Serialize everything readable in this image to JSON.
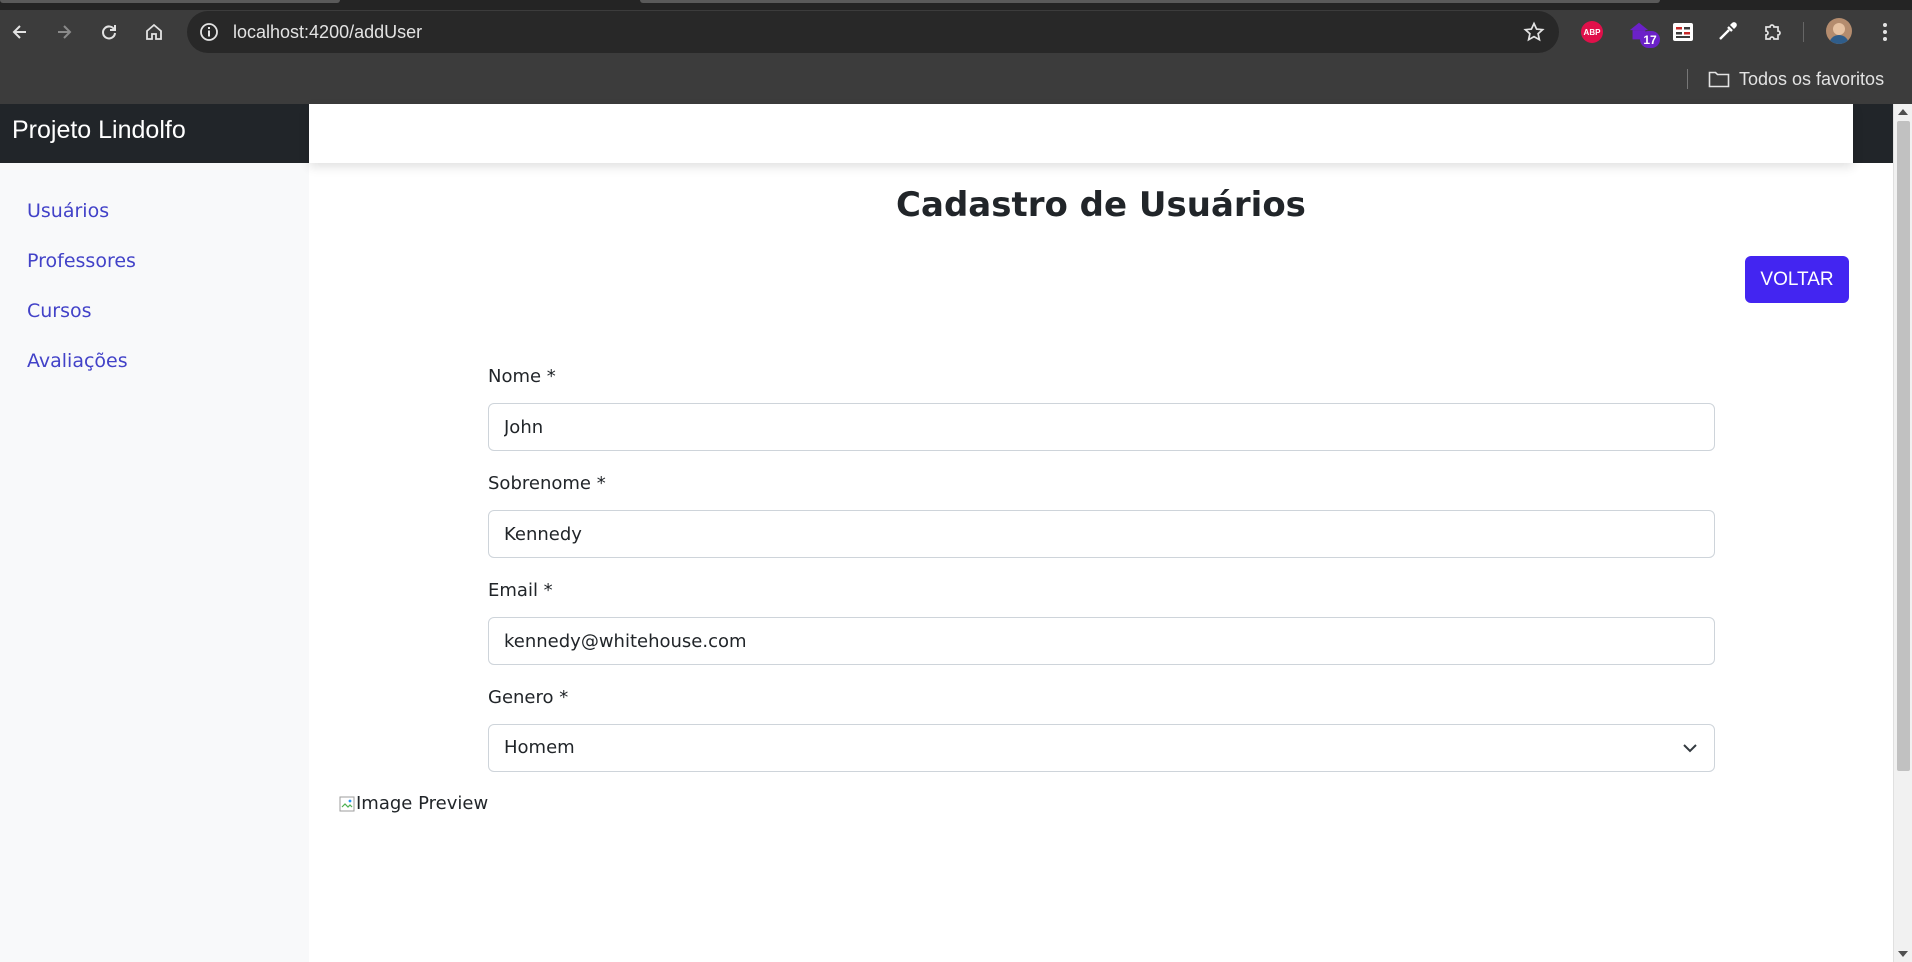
{
  "browser": {
    "url": "localhost:4200/addUser",
    "extension_badge": "17",
    "abp_label": "ABP",
    "bookmarks_label": "Todos os favoritos",
    "icons": [
      "back-icon",
      "forward-icon",
      "reload-icon",
      "home-icon",
      "info-icon",
      "star-icon",
      "adblock-icon",
      "extension-icon",
      "reader-icon",
      "eyedropper-icon",
      "puzzle-icon",
      "avatar",
      "menu-icon",
      "folder-icon"
    ]
  },
  "app": {
    "brand": "Projeto Lindolfo"
  },
  "sidebar": {
    "items": [
      {
        "label": "Usuários"
      },
      {
        "label": "Professores"
      },
      {
        "label": "Cursos"
      },
      {
        "label": "Avaliações"
      }
    ]
  },
  "main": {
    "title": "Cadastro de Usuários",
    "back_button": "VOLTAR",
    "fields": {
      "nome": {
        "label": "Nome *",
        "value": "John"
      },
      "sobrenome": {
        "label": "Sobrenome *",
        "value": "Kennedy"
      },
      "email": {
        "label": "Email *",
        "value": "kennedy@whitehouse.com"
      },
      "genero": {
        "label": "Genero *",
        "value": "Homem"
      }
    },
    "image_preview_alt": "Image Preview"
  },
  "colors": {
    "accent": "#4325f1",
    "link": "#4242c8",
    "dark": "#212529"
  }
}
